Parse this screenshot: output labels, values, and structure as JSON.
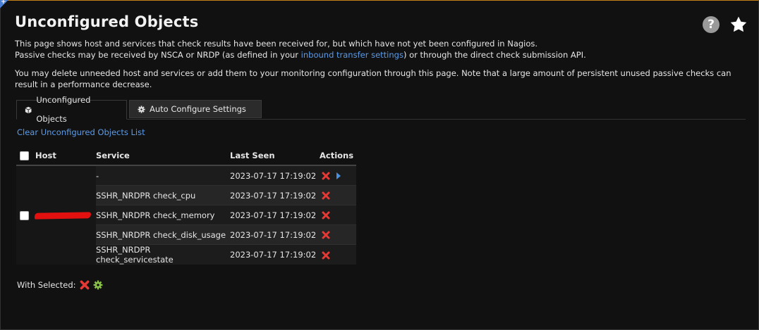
{
  "page": {
    "title": "Unconfigured Objects",
    "desc_line1": "This page shows host and services that check results have been received for, but which have not yet been configured in Nagios.",
    "desc_line2_before": "Passive checks may be received by NSCA or NRDP (as defined in your ",
    "desc_line2_link": "inbound transfer settings",
    "desc_line2_after": ") or through the direct check submission API.",
    "desc_para2": "You may delete unneeded host and services or add them to your monitoring configuration through this page. Note that a large amount of persistent unused passive checks can result in a performance decrease."
  },
  "tabs": [
    {
      "label": "Unconfigured Objects",
      "icon": "cube-icon",
      "active": true
    },
    {
      "label": "Auto Configure Settings",
      "icon": "gear-icon",
      "active": false
    }
  ],
  "clear_link": "Clear Unconfigured Objects List",
  "table": {
    "headers": {
      "host": "Host",
      "service": "Service",
      "last_seen": "Last Seen",
      "actions": "Actions"
    },
    "rows": [
      {
        "service": "-",
        "last_seen": "2023-07-17 17:19:02"
      },
      {
        "service": "SSHR_NRDPR check_cpu",
        "last_seen": "2023-07-17 17:19:02"
      },
      {
        "service": "SSHR_NRDPR check_memory",
        "last_seen": "2023-07-17 17:19:02"
      },
      {
        "service": "SSHR_NRDPR check_disk_usage",
        "last_seen": "2023-07-17 17:19:02"
      },
      {
        "service": "SSHR_NRDPR check_servicestate",
        "last_seen": "2023-07-17 17:19:02"
      }
    ]
  },
  "with_selected": "With Selected:",
  "colors": {
    "link": "#5b9bea",
    "delete": "#e53935",
    "accent_top": "#c67f17",
    "background": "#111111"
  }
}
